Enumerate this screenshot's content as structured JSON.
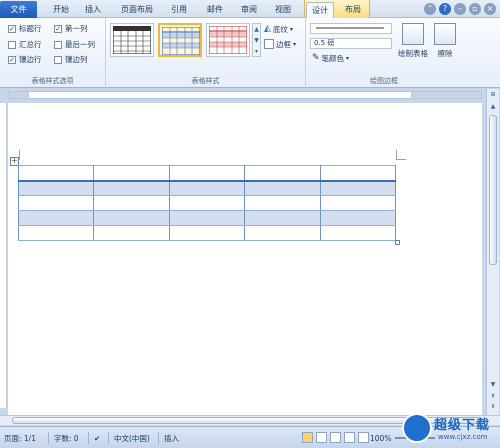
{
  "tabs": {
    "file": "文件",
    "items": [
      "开始",
      "插入",
      "页面布局",
      "引用",
      "邮件",
      "审阅",
      "视图",
      "设计",
      "布局"
    ],
    "active": "设计"
  },
  "ribbon": {
    "style_options": {
      "label": "表格样式选项",
      "options": [
        {
          "label": "标题行",
          "checked": true
        },
        {
          "label": "第一列",
          "checked": true
        },
        {
          "label": "汇总行",
          "checked": false
        },
        {
          "label": "最后一列",
          "checked": false
        },
        {
          "label": "镶边行",
          "checked": true
        },
        {
          "label": "镶边列",
          "checked": false
        }
      ]
    },
    "table_styles": {
      "label": "表格样式",
      "shading": "底纹",
      "borders": "边框"
    },
    "draw_borders": {
      "label": "绘图边框",
      "weight": "0.5 磅",
      "pen_color": "笔颜色",
      "draw_table": "绘制表格",
      "eraser": "擦除"
    }
  },
  "status": {
    "page": "页面: 1/1",
    "words": "字数: 0",
    "language": "中文(中国)",
    "mode": "插入",
    "zoom": "100%"
  },
  "watermark": {
    "text": "超级下载",
    "url": "www.cjxz.com"
  },
  "colors": {
    "file_tab": "#2a6bc9",
    "band_row": "#d3dff0",
    "table_border": "#6f93c9"
  }
}
